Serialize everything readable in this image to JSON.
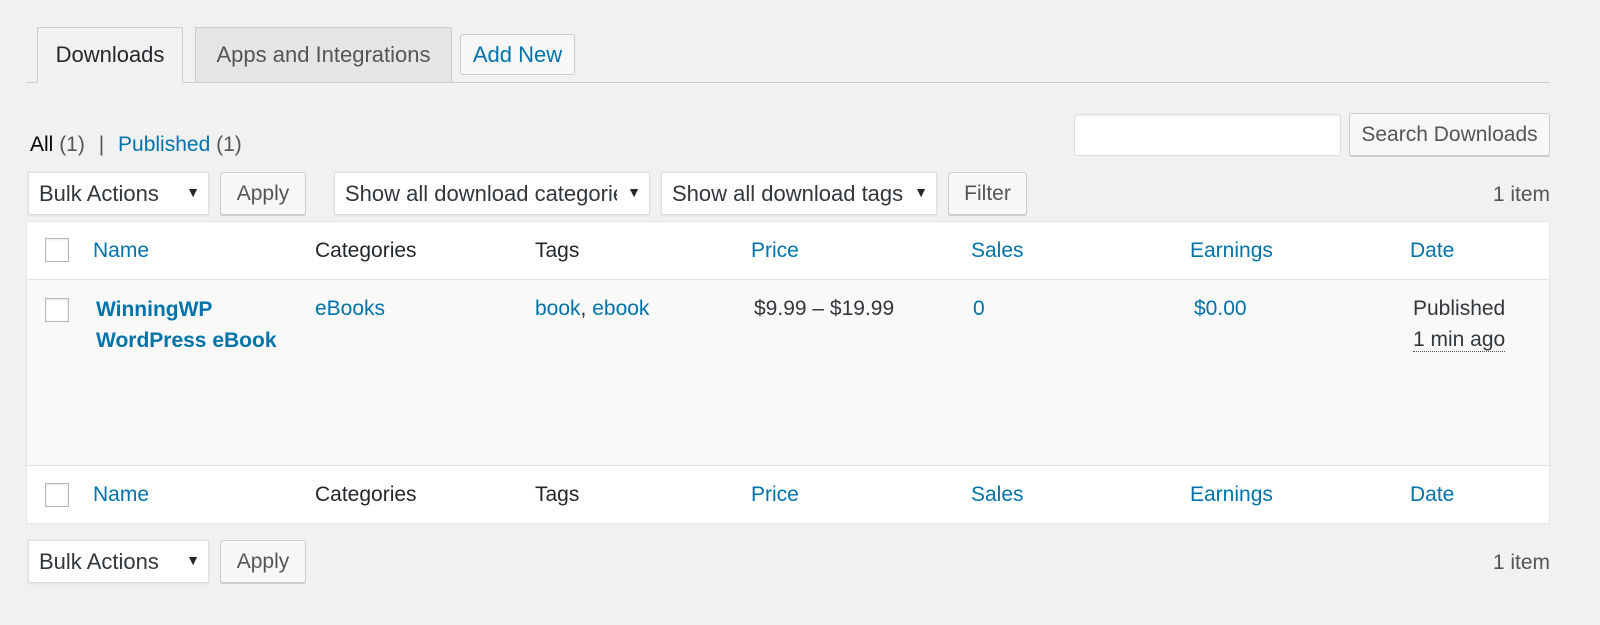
{
  "tabs": {
    "active": "Downloads",
    "inactive": "Apps and Integrations",
    "add_new": "Add New"
  },
  "filters_links": {
    "all_label": "All",
    "all_count": "(1)",
    "separator": "|",
    "published_label": "Published",
    "published_count": "(1)"
  },
  "search": {
    "value": "",
    "button": "Search Downloads"
  },
  "top_nav": {
    "bulk_actions": "Bulk Actions",
    "apply": "Apply",
    "category_filter": "Show all download categories",
    "tag_filter": "Show all download tags",
    "filter": "Filter",
    "items_count": "1 item"
  },
  "bottom_nav": {
    "bulk_actions": "Bulk Actions",
    "apply": "Apply",
    "items_count": "1 item"
  },
  "columns": {
    "name": "Name",
    "categories": "Categories",
    "tags": "Tags",
    "price": "Price",
    "sales": "Sales",
    "earnings": "Earnings",
    "date": "Date"
  },
  "rows": [
    {
      "title": "WinningWP WordPress eBook",
      "category": "eBooks",
      "tag1": "book",
      "tag_sep": ", ",
      "tag2": "ebook",
      "price": "$9.99 – $19.99",
      "sales": "0",
      "earnings": "$0.00",
      "status": "Published",
      "date": "1 min ago"
    }
  ],
  "colors": {
    "link": "#0073aa",
    "background": "#f1f1f1",
    "text": "#23282d"
  },
  "icons": [
    "dropdown-arrow-icon"
  ]
}
